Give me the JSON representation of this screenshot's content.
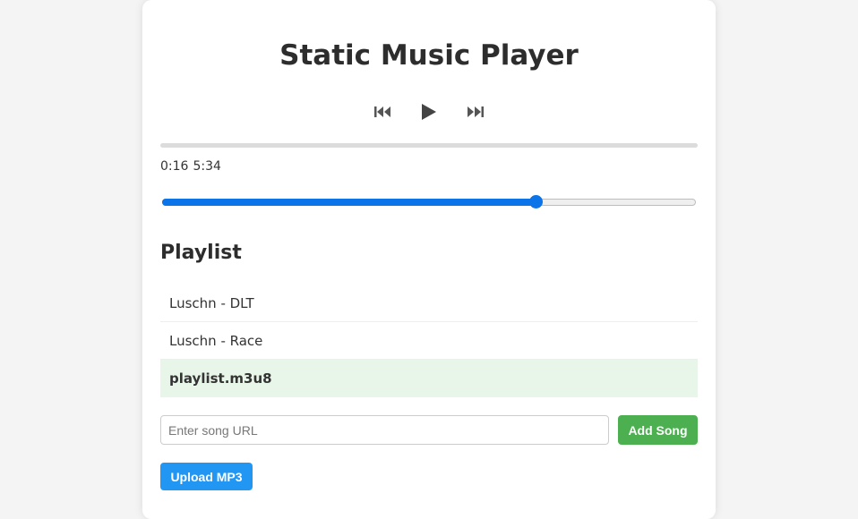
{
  "player": {
    "title": "Static Music Player",
    "controls": [
      {
        "icon": "previous-icon",
        "symbol": "⏮"
      },
      {
        "icon": "play-icon",
        "symbol": "▶"
      },
      {
        "icon": "next-icon",
        "symbol": "⏭"
      }
    ],
    "progress_fraction": 0.0,
    "current_time": "0:16",
    "duration": "5:34",
    "volume_fraction": 0.7
  },
  "playlist": {
    "heading": "Playlist",
    "items": [
      {
        "label": "Luschn - DLT",
        "active": false
      },
      {
        "label": "Luschn - Race",
        "active": false
      },
      {
        "label": "playlist.m3u8",
        "active": true
      }
    ]
  },
  "add_song": {
    "placeholder": "Enter song URL",
    "value": "",
    "button_label": "Add Song"
  },
  "upload": {
    "button_label": "Upload MP3"
  },
  "colors": {
    "page_background": "#f4f4f4",
    "accent_blue": "#0a74e8",
    "add_button": "#4caf50",
    "upload_button": "#2196f3",
    "active_row": "#e8f5e9"
  }
}
